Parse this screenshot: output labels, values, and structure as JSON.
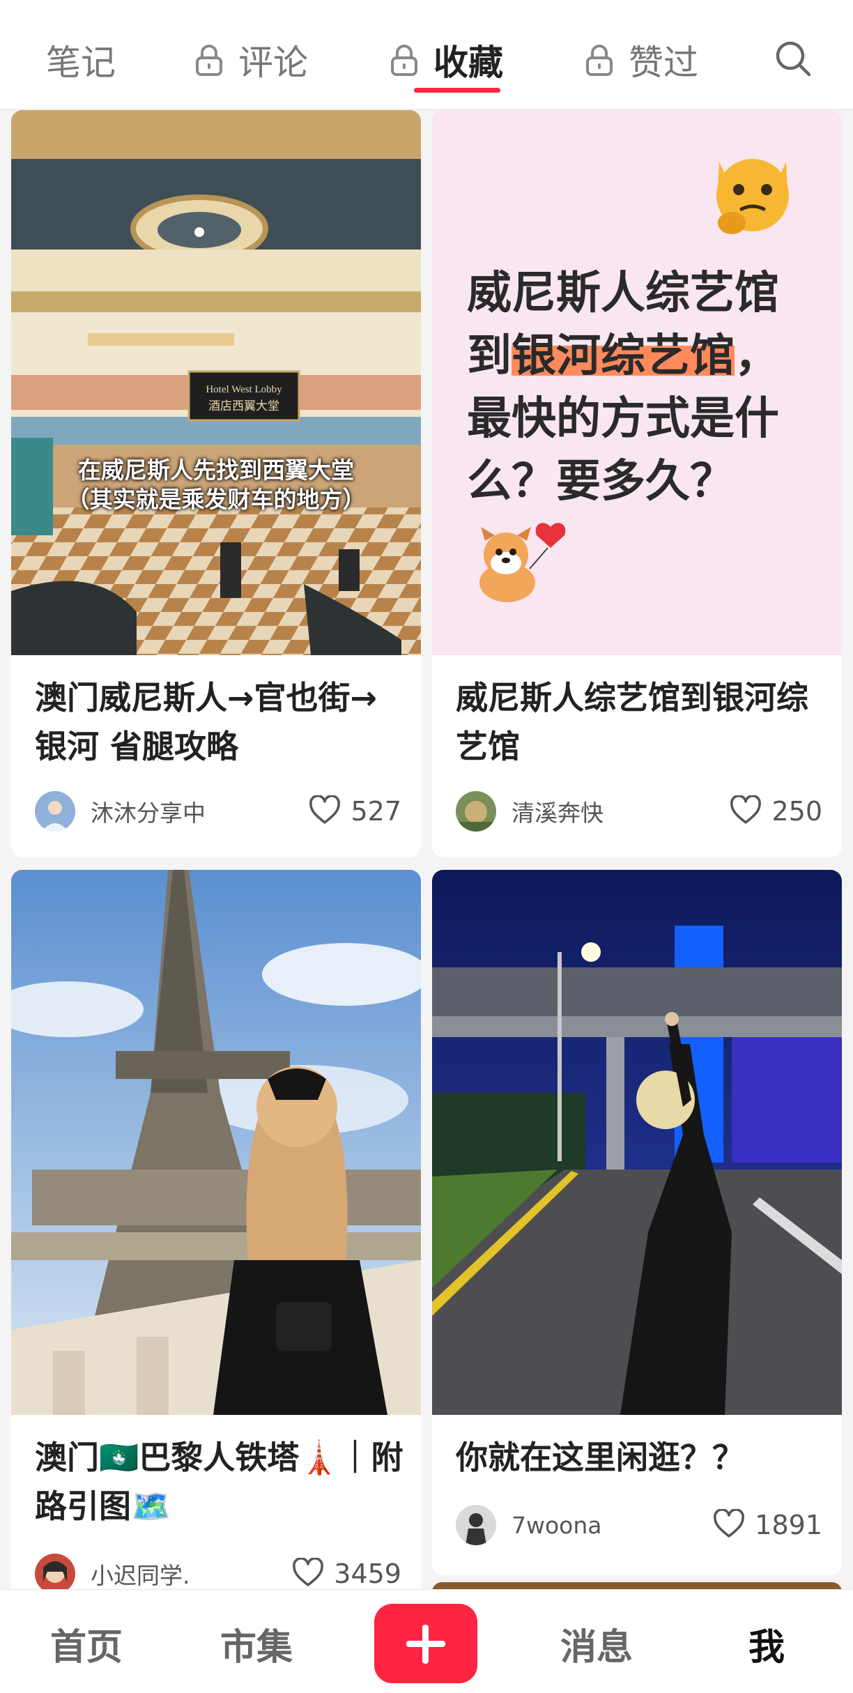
{
  "tabs": {
    "notes": "笔记",
    "comments": "评论",
    "collections": "收藏",
    "likes": "赞过"
  },
  "icons": {
    "lock": "lock-icon",
    "search": "search-icon",
    "heart": "heart-outline-icon",
    "plus": "plus-icon"
  },
  "colors": {
    "accent": "#ff2442",
    "highlight": "#ff8a5c",
    "pink_card_bg": "#f9e6f1"
  },
  "cards": [
    {
      "image_caption_line1": "在威尼斯人先找到西翼大堂",
      "image_caption_line2": "（其实就是乘发财车的地方）",
      "sign_line1": "Hotel West Lobby",
      "sign_line2": "酒店西翼大堂",
      "title": "澳门威尼斯人→官也街→银河 省腿攻略",
      "author": "沐沐分享中",
      "likes": "527"
    },
    {
      "image_text_line1": "威尼斯人综艺馆",
      "image_text_line2_a": "到",
      "image_text_line2_hl": "银河综艺馆",
      "image_text_line2_b": "，",
      "image_text_line3": "最快的方式是什",
      "image_text_line4": "么？要多久？",
      "title": "威尼斯人综艺馆到银河综艺馆",
      "author": "清溪奔快",
      "likes": "250"
    },
    {
      "title": "澳门🇲🇴巴黎人铁塔🗼｜附路引图🗺️",
      "author": "小迟同学.",
      "likes": "3459"
    },
    {
      "title": "你就在这里闲逛？？",
      "author": "7woona",
      "likes": "1891"
    }
  ],
  "bottom_nav": {
    "home": "首页",
    "market": "市集",
    "messages": "消息",
    "me": "我"
  }
}
